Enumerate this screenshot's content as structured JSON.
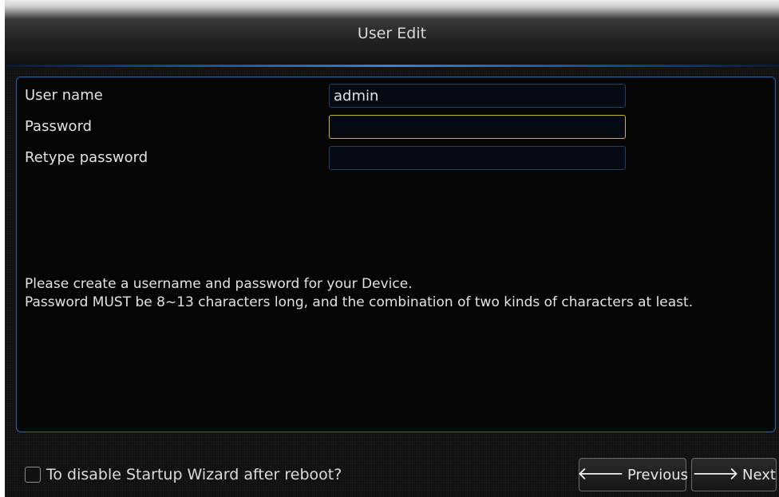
{
  "window": {
    "title": "User Edit"
  },
  "form": {
    "username": {
      "label": "User name",
      "value": "admin"
    },
    "password": {
      "label": "Password",
      "value": ""
    },
    "retype_password": {
      "label": "Retype password",
      "value": ""
    }
  },
  "help": {
    "line1": "Please create a username and password for your Device.",
    "line2": "Password MUST be 8~13 characters long, and the combination of two kinds of characters at least."
  },
  "footer": {
    "disable_wizard_label": "To disable Startup Wizard after reboot?",
    "disable_wizard_checked": false,
    "previous_label": "Previous",
    "next_label": "Next",
    "previous_icon": "arrow-left-icon",
    "next_icon": "arrow-right-icon"
  },
  "colors": {
    "focus_border": "#c9b51e",
    "panel_border": "#2a5f9a",
    "accent_blue": "#3a7fd8"
  }
}
